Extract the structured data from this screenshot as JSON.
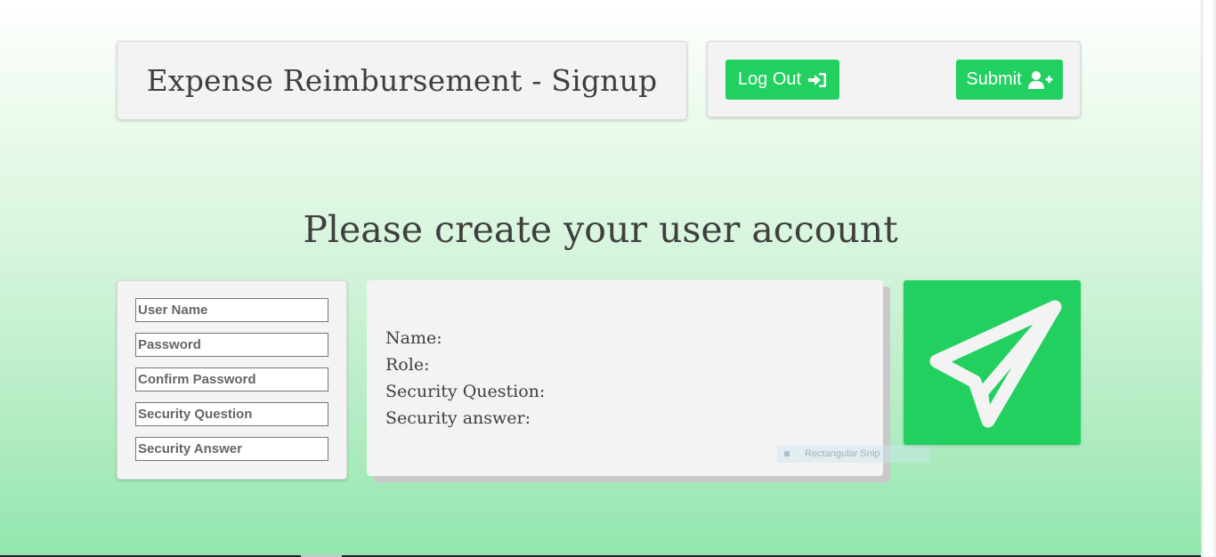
{
  "header": {
    "title": "Expense Reimbursement - Signup"
  },
  "actions": {
    "logout_label": "Log Out",
    "submit_label": "Submit",
    "logout_icon": "sign-in-icon",
    "submit_icon": "user-plus-icon"
  },
  "main": {
    "heading": "Please create your user account"
  },
  "form": {
    "username_placeholder": "User Name",
    "password_placeholder": "Password",
    "confirm_password_placeholder": "Confirm Password",
    "security_question_placeholder": "Security Question",
    "security_answer_placeholder": "Security Answer"
  },
  "preview": {
    "name_label": "Name:",
    "role_label": "Role:",
    "security_question_label": "Security Question:",
    "security_answer_label": "Security answer:"
  },
  "overlay": {
    "snip_text": "Rectangular Snip"
  },
  "logo": {
    "icon": "paper-plane-icon"
  },
  "colors": {
    "accent": "#22d060",
    "card_bg": "#f3f3f3",
    "text": "#3f3f3f"
  }
}
